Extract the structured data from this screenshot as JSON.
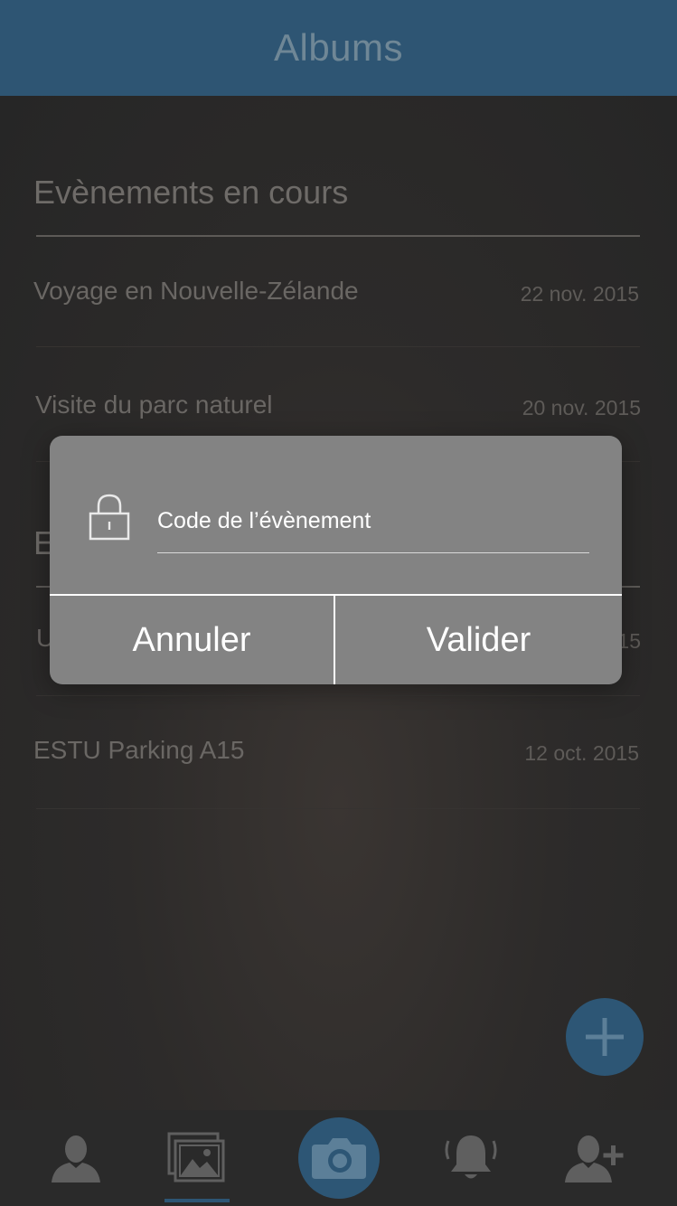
{
  "header": {
    "title": "Albums"
  },
  "sections": {
    "current": {
      "title": "Evènements en cours",
      "items": [
        {
          "title": "Voyage en Nouvelle-Zélande",
          "date": "22 nov. 2015"
        },
        {
          "title": "Visite du parc naturel",
          "date": "20 nov. 2015"
        }
      ]
    },
    "past": {
      "title_partial": "E",
      "items": [
        {
          "title_partial": "U",
          "date_partial": "15"
        },
        {
          "title": "ESTU Parking A15",
          "date": "12 oct. 2015"
        }
      ]
    }
  },
  "dialog": {
    "input_placeholder": "Code de l’évènement",
    "cancel_label": "Annuler",
    "confirm_label": "Valider"
  },
  "tabbar": {
    "items": [
      "profile-icon",
      "albums-icon",
      "camera-icon",
      "notifications-icon",
      "add-friend-icon"
    ],
    "active": "albums-icon"
  },
  "colors": {
    "header": "#2e5573",
    "accent": "#2d5675",
    "dialog": "#838383"
  }
}
